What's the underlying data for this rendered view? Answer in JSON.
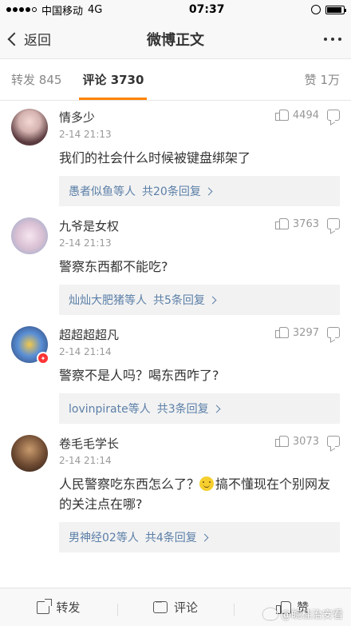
{
  "status": {
    "carrier": "中国移动",
    "network": "4G",
    "time": "07:37",
    "battery_level": 0.9
  },
  "nav": {
    "back_label": "返回",
    "title": "微博正文"
  },
  "tabs": {
    "repost_label": "转发",
    "repost_count": "845",
    "comment_label": "评论",
    "comment_count": "3730",
    "like_label": "赞",
    "like_count": "1万"
  },
  "comments": [
    {
      "name": "情多少",
      "time": "2-14 21:13",
      "likes": "4494",
      "text": "我们的社会什么时候被键盘绑架了",
      "reply_users": "愚者似鱼等人",
      "reply_count": "共20条回复"
    },
    {
      "name": "九爷是女权",
      "time": "2-14 21:13",
      "likes": "3763",
      "text": "警察东西都不能吃?",
      "reply_users": "灿灿大肥猪等人",
      "reply_count": "共5条回复"
    },
    {
      "name": "超超超超凡",
      "time": "2-14 21:14",
      "likes": "3297",
      "text": "警察不是人吗？喝东西咋了?",
      "reply_users": "lovinpirate等人",
      "reply_count": "共3条回复"
    },
    {
      "name": "卷毛毛学长",
      "time": "2-14 21:14",
      "likes": "3073",
      "text_before": "人民警察吃东西怎么了？",
      "text_after": "搞不懂现在个别网友的关注点在哪?",
      "reply_users": "男神经02等人",
      "reply_count": "共4条回复"
    }
  ],
  "bottom": {
    "repost_label": "转发",
    "comment_label": "评论",
    "like_label": "赞"
  },
  "watermark": {
    "text": "@皖桂治安看"
  }
}
